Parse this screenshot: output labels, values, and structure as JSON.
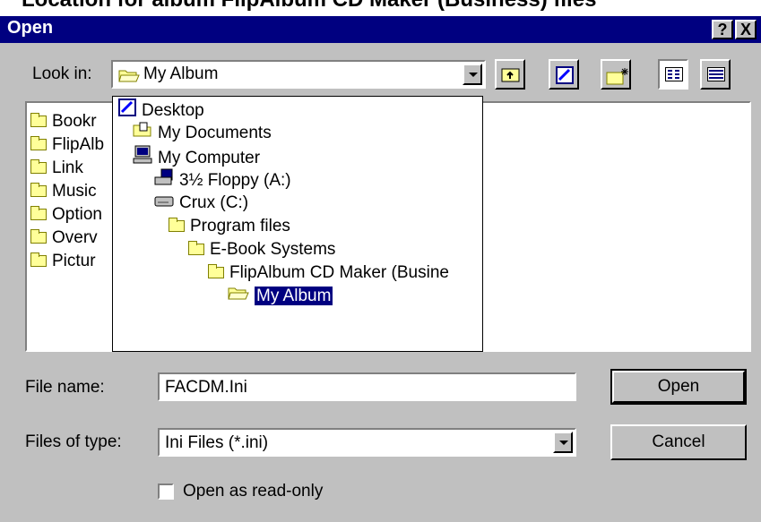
{
  "background_text": "Location for album FlipAlbum CD Maker (Business) files",
  "window": {
    "title": "Open",
    "help_label": "?",
    "close_label": "X"
  },
  "look_in": {
    "label": "Look in:",
    "value": "My Album"
  },
  "file_list": {
    "items": [
      "Bookr",
      "FlipAlb",
      "Link",
      "Music",
      "Option",
      "Overv",
      "Pictur"
    ]
  },
  "tree": {
    "items": [
      {
        "label": "Desktop",
        "icon": "desktop-icon"
      },
      {
        "label": "My Documents",
        "icon": "my-documents-icon"
      },
      {
        "label": "My Computer",
        "icon": "my-computer-icon"
      },
      {
        "label": "3½ Floppy (A:)",
        "icon": "floppy-drive-icon"
      },
      {
        "label": "Crux (C:)",
        "icon": "hard-drive-icon"
      },
      {
        "label": "Program files",
        "icon": "folder-icon"
      },
      {
        "label": "E-Book Systems",
        "icon": "folder-icon"
      },
      {
        "label": "FlipAlbum CD Maker (Busine",
        "icon": "folder-icon"
      },
      {
        "label": "My Album",
        "icon": "open-folder-icon",
        "selected": true
      }
    ]
  },
  "file_name": {
    "label": "File name:",
    "value": "FACDM.Ini"
  },
  "files_of_type": {
    "label": "Files of type:",
    "value": "Ini Files (*.ini)"
  },
  "read_only": {
    "label": "Open as read-only",
    "checked": false
  },
  "buttons": {
    "open": "Open",
    "cancel": "Cancel"
  },
  "colors": {
    "titlebar": "#000080",
    "dialog": "#c0c0c0",
    "selection": "#000080"
  }
}
